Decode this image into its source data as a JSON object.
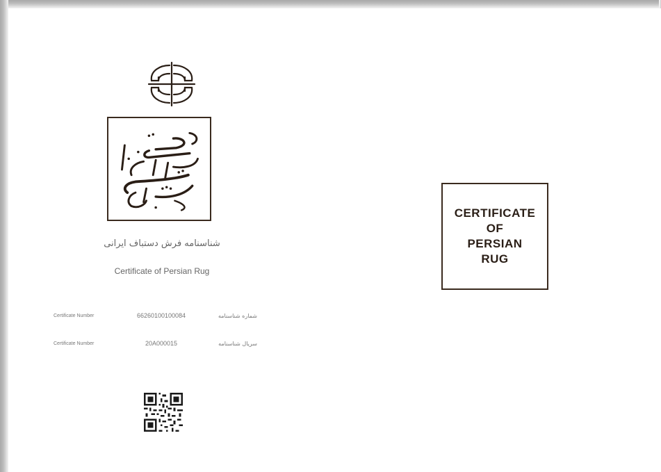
{
  "left_page": {
    "logo_icon": "interlocked-crescent-emblem",
    "calligraphy_text": "شناسنامه فرش دستباف ایرانی",
    "title_fa": "شناسنامه فرش دستباف ایرانی",
    "title_en": "Certificate of Persian Rug",
    "rows": [
      {
        "label_en": "Certificate Number",
        "value": "66260100100084",
        "label_fa": "شماره شناسنامه"
      },
      {
        "label_en": "Certificate Number",
        "value": "20A000015",
        "label_fa": "سریال شناسنامه"
      }
    ],
    "qr_icon": "qr-code"
  },
  "right_page": {
    "cover_lines": [
      "CERTIFICATE",
      "OF",
      "PERSIAN",
      "RUG"
    ]
  },
  "colors": {
    "ink": "#3a2a1e",
    "muted_text": "#666666"
  }
}
